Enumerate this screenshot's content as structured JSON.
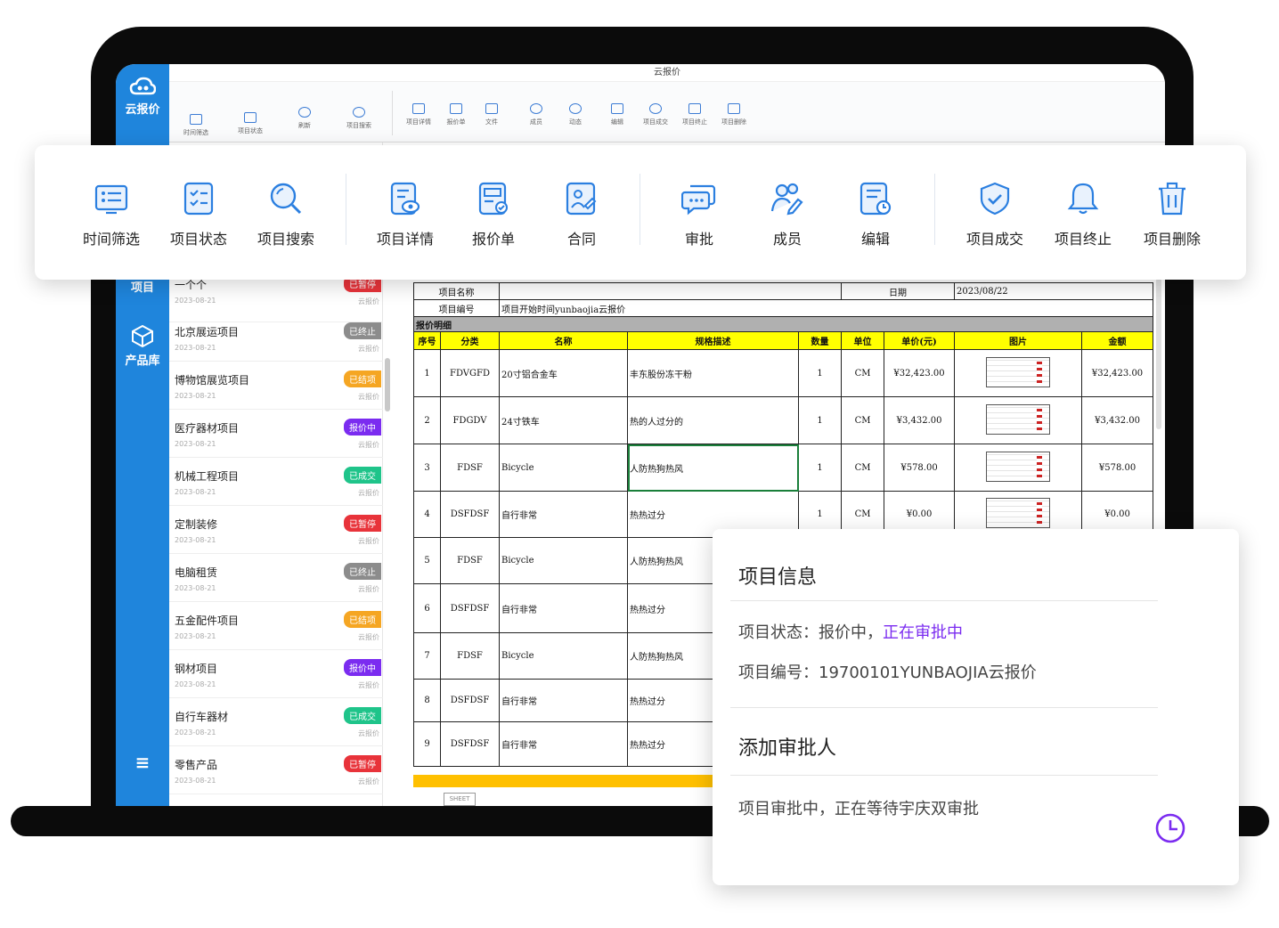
{
  "app": {
    "window_title": "云报价",
    "brand": "云报价",
    "nav": {
      "project": "项目",
      "products": "产品库",
      "menu_icon": "hamburger-icon"
    }
  },
  "mini_toolbar": [
    "时间筛选",
    "项目状态",
    "刷新",
    "项目搜索",
    "项目详情",
    "报价单",
    "文件",
    "成员",
    "动态",
    "编辑",
    "项目成交",
    "项目终止",
    "项目删除"
  ],
  "toolbar": {
    "time_filter": "时间筛选",
    "project_status": "项目状态",
    "project_search": "项目搜索",
    "project_detail": "项目详情",
    "quote": "报价单",
    "contract": "合同",
    "approve": "审批",
    "members": "成员",
    "edit": "编辑",
    "deal": "项目成交",
    "terminate": "项目终止",
    "delete": "项目删除",
    "accent": "#2b7fe0"
  },
  "projects": [
    {
      "name": "一个个",
      "date": "2023-08-21",
      "status": "已暂停",
      "tag": "云报价",
      "color": "#e8333a"
    },
    {
      "name": "北京展运项目",
      "date": "2023-08-21",
      "status": "已终止",
      "tag": "云报价",
      "color": "#8c8c8c"
    },
    {
      "name": "博物馆展览项目",
      "date": "2023-08-21",
      "status": "已结项",
      "tag": "云报价",
      "color": "#f5a623"
    },
    {
      "name": "医疗器材项目",
      "date": "2023-08-21",
      "status": "报价中",
      "tag": "云报价",
      "color": "#7b2cf0"
    },
    {
      "name": "机械工程项目",
      "date": "2023-08-21",
      "status": "已成交",
      "tag": "云报价",
      "color": "#1fc48a"
    },
    {
      "name": "定制装修",
      "date": "2023-08-21",
      "status": "已暂停",
      "tag": "云报价",
      "color": "#e8333a"
    },
    {
      "name": "电脑租赁",
      "date": "2023-08-21",
      "status": "已终止",
      "tag": "云报价",
      "color": "#8c8c8c"
    },
    {
      "name": "五金配件项目",
      "date": "2023-08-21",
      "status": "已结项",
      "tag": "云报价",
      "color": "#f5a623"
    },
    {
      "name": "钢材项目",
      "date": "2023-08-21",
      "status": "报价中",
      "tag": "云报价",
      "color": "#7b2cf0"
    },
    {
      "name": "自行车器材",
      "date": "2023-08-21",
      "status": "已成交",
      "tag": "云报价",
      "color": "#1fc48a"
    },
    {
      "name": "零售产品",
      "date": "2023-08-21",
      "status": "已暂停",
      "tag": "云报价",
      "color": "#e8333a"
    }
  ],
  "sheet": {
    "project_name_label": "项目名称",
    "date_label": "日期",
    "date_value": "2023/08/22",
    "project_no_label": "项目编号",
    "project_no_value": "项目开始时间yunbaojia云报价",
    "section_title": "报价明细",
    "headers": [
      "序号",
      "分类",
      "名称",
      "规格描述",
      "数量",
      "单位",
      "单价(元)",
      "图片",
      "金额"
    ],
    "rows": [
      {
        "no": "1",
        "cat": "FDVGFD",
        "name": "20寸铝合金车",
        "spec": "丰东股份冻干粉",
        "qty": "1",
        "unit": "CM",
        "price": "¥32,423.00",
        "amount": "¥32,423.00"
      },
      {
        "no": "2",
        "cat": "FDGDV",
        "name": "24寸铁车",
        "spec": "热的人过分的",
        "qty": "1",
        "unit": "CM",
        "price": "¥3,432.00",
        "amount": "¥3,432.00"
      },
      {
        "no": "3",
        "cat": "FDSF",
        "name": "Bicycle",
        "spec": "人防热狗热风",
        "qty": "1",
        "unit": "CM",
        "price": "¥578.00",
        "amount": "¥578.00"
      },
      {
        "no": "4",
        "cat": "DSFDSF",
        "name": "自行非常",
        "spec": "热热过分",
        "qty": "1",
        "unit": "CM",
        "price": "¥0.00",
        "amount": "¥0.00"
      },
      {
        "no": "5",
        "cat": "FDSF",
        "name": "Bicycle",
        "spec": "人防热狗热风",
        "qty": "",
        "unit": "",
        "price": "",
        "amount": ""
      },
      {
        "no": "6",
        "cat": "DSFDSF",
        "name": "自行非常",
        "spec": "热热过分",
        "qty": "",
        "unit": "",
        "price": "",
        "amount": ""
      },
      {
        "no": "7",
        "cat": "FDSF",
        "name": "Bicycle",
        "spec": "人防热狗热风",
        "qty": "",
        "unit": "",
        "price": "",
        "amount": ""
      },
      {
        "no": "8",
        "cat": "DSFDSF",
        "name": "自行非常",
        "spec": "热热过分",
        "qty": "",
        "unit": "",
        "price": "",
        "amount": ""
      },
      {
        "no": "9",
        "cat": "DSFDSF",
        "name": "自行非常",
        "spec": "热热过分",
        "qty": "",
        "unit": "",
        "price": "",
        "amount": ""
      }
    ],
    "tab": "SHEET"
  },
  "info": {
    "title": "项目信息",
    "status_label": "项目状态：报价中，",
    "status_highlight": "正在审批中",
    "number_label": "项目编号：19700101YUNBAOJIA云报价",
    "approver_title": "添加审批人",
    "approver_text": "项目审批中，正在等待宇庆双审批",
    "highlight_color": "#7b2cf0"
  }
}
